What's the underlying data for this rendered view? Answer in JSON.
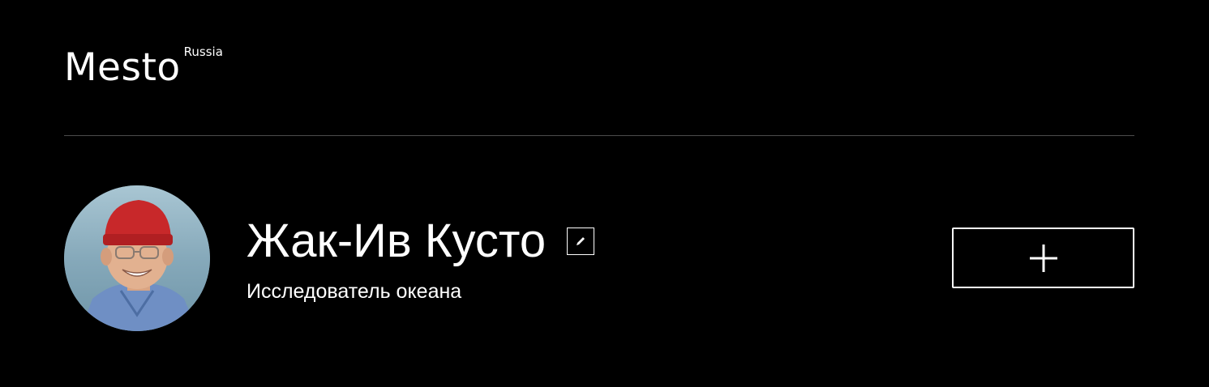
{
  "header": {
    "logo_text": "Mesto",
    "logo_superscript": "Russia"
  },
  "profile": {
    "name": "Жак-Ив Кусто",
    "about": "Исследователь океана",
    "avatar_icon": "avatar-photo"
  },
  "icons": {
    "edit": "pencil-icon",
    "add": "plus-icon"
  },
  "colors": {
    "background": "#000000",
    "text": "#ffffff",
    "divider": "#545454",
    "cap": "#c8282a"
  }
}
